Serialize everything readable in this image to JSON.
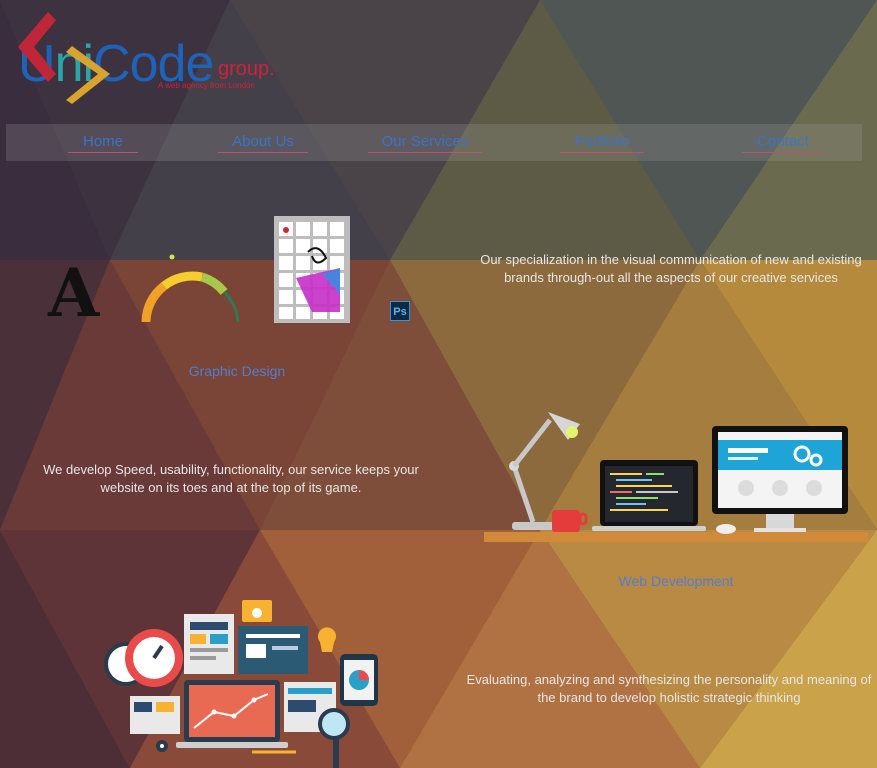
{
  "brand": {
    "logo_u": "U",
    "logo_ni": "ni",
    "logo_code": "Code",
    "logo_group": "group.",
    "tagline": "A web agency from London"
  },
  "nav": {
    "items": [
      {
        "label": "Home"
      },
      {
        "label": "About Us"
      },
      {
        "label": "Our Services"
      },
      {
        "label": "Portfolio"
      },
      {
        "label": "Contact"
      }
    ]
  },
  "sections": {
    "graphic": {
      "text": "Our specialization in the visual communication of new and existing brands through-out all the aspects of our creative services",
      "caption": "Graphic Design",
      "letter": "A",
      "ps_label": "Ps"
    },
    "web": {
      "text": "We develop Speed, usability, functionality, our service keeps your website on its toes and at the top of its game.",
      "caption": "Web Development"
    },
    "strategy": {
      "text": "Evaluating, analyzing and synthesizing the personality and meaning of the brand to develop holistic strategic thinking"
    }
  },
  "colors": {
    "accent_blue": "#3b73c9",
    "brand_red": "#d0213a",
    "caption_blue": "#4f7fd0"
  }
}
